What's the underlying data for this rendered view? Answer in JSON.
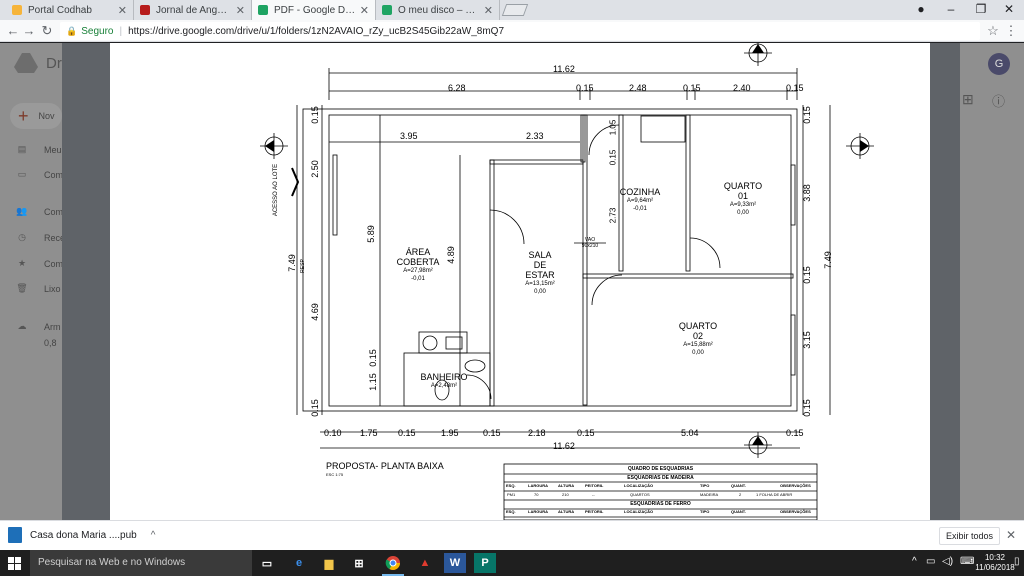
{
  "browser": {
    "tabs": [
      {
        "title": "Portal Codhab",
        "color": "#f6b43a"
      },
      {
        "title": "Jornal de Angola - Online",
        "color": "#b71c1c"
      },
      {
        "title": "PDF - Google Drive",
        "color": "#1fa463"
      },
      {
        "title": "O meu disco – Google Dr",
        "color": "#1fa463"
      }
    ],
    "secure_label": "Seguro",
    "url": "https://drive.google.com/drive/u/1/folders/1zN2AVAIO_rZy_ucB2S45Gib22aW_8mQ7"
  },
  "drive": {
    "logo_text": "Dri",
    "new_label": "Nov",
    "sidebar": [
      {
        "label": "Meu",
        "icon": "drive-icon"
      },
      {
        "label": "Com",
        "icon": "computer-icon"
      },
      {
        "label": "Com",
        "icon": "shared-icon"
      },
      {
        "label": "Rece",
        "icon": "recent-icon"
      },
      {
        "label": "Com",
        "icon": "star-icon"
      },
      {
        "label": "Lixo",
        "icon": "trash-icon"
      },
      {
        "label": "Arm",
        "icon": "cloud-icon"
      },
      {
        "label": "0,8",
        "icon": ""
      }
    ],
    "avatar_letter": "G"
  },
  "plan": {
    "top_total": "11.62",
    "top_dims": [
      "6.28",
      "0.15",
      "2.48",
      "0.15",
      "2.40",
      "0.15"
    ],
    "inner_dims": [
      "3.95",
      "2.33"
    ],
    "left_dims": [
      "0.15",
      "2.50",
      "7.49",
      "4.69",
      "0.15",
      "1.15",
      "0.15"
    ],
    "left_label_sub": "RESP",
    "right_dims": [
      "0.15",
      "3.88",
      "7.49",
      "0.15",
      "3.15",
      "0.15"
    ],
    "bottom_dims": [
      "0.10",
      "1.75",
      "0.15",
      "1.95",
      "0.15",
      "2.18",
      "0.15",
      "5.04",
      "0.15"
    ],
    "bottom_total": "11.62",
    "area_coberta": {
      "name1": "ÁREA",
      "name2": "COBERTA",
      "area": "A=27,98m²",
      "level": "-0,01",
      "dim_v": "5.89",
      "dim_v2": "4.89"
    },
    "sala": {
      "name1": "SALA",
      "name2": "DE",
      "name3": "ESTAR",
      "area": "A=13,15m²",
      "level": "0,00"
    },
    "vao": {
      "label": "VAO",
      "size": "90x210"
    },
    "cozinha": {
      "name": "COZINHA",
      "area": "A=9,64m²",
      "level": "-0,01",
      "dim1": "1.05",
      "dim2": "0.15",
      "dim3": "2.73"
    },
    "quarto01": {
      "name1": "QUARTO",
      "name2": "01",
      "area": "A=9,33m²",
      "level": "0,00"
    },
    "quarto02": {
      "name1": "QUARTO",
      "name2": "02",
      "area": "A=15,88m²",
      "level": "0,00"
    },
    "banheiro": {
      "name": "BANHEIRO",
      "area": "A=2,48m²"
    },
    "acesso": "ACESSO AO LOTE",
    "title": "PROPOSTA- PLANTA BAIXA",
    "scale": "ESC 1:75",
    "table": {
      "title": "QUADRO DE ESQUADRIAS",
      "sub1": "ESQUADRIAS DE MADEIRA",
      "headers": [
        "ESQ.",
        "LARGURA",
        "ALTURA",
        "PEITORIL",
        "LOCALIZAÇÃO",
        "TIPO",
        "QUANT.",
        "OBSERVAÇÕES"
      ],
      "row1": [
        "PM1",
        "70",
        "210",
        "--",
        "QUARTOS",
        "MADEIRA",
        "2",
        "1 FOLHA DE ABRIR"
      ],
      "sub2": "ESQUADRIAS DE FERRO"
    }
  },
  "downloads": {
    "file": "Casa dona Maria ....pub",
    "show_all": "Exibir todos"
  },
  "taskbar": {
    "search": "Pesquisar na Web e no Windows",
    "time": "10:32",
    "date": "11/06/2018"
  }
}
